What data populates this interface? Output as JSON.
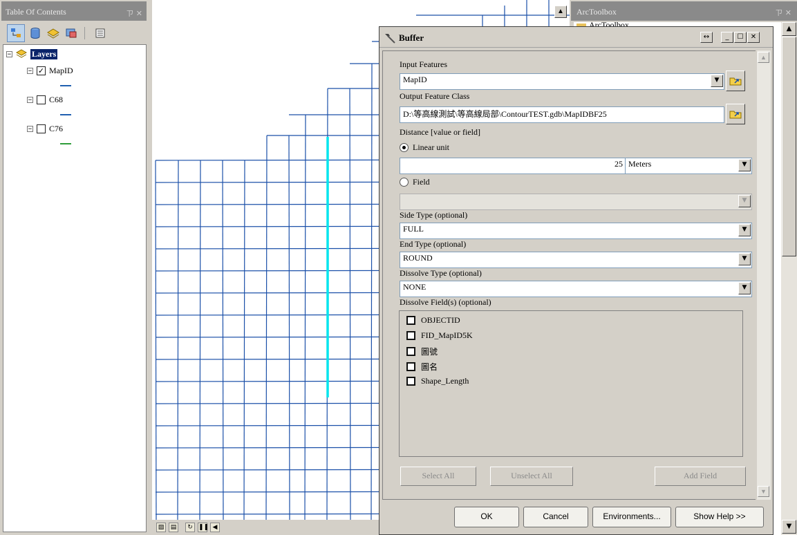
{
  "toc": {
    "title": "Table Of Contents",
    "pin": "ㄗ ✕",
    "toolbar": [
      "list-by-drawing-order",
      "list-by-source",
      "list-by-visibility",
      "list-by-selection",
      "options"
    ],
    "root_label": "Layers",
    "layers": [
      {
        "name": "MapID",
        "checked": true,
        "symbol_color": "#1f5fb0"
      },
      {
        "name": "C68",
        "checked": false,
        "symbol_color": "#1f5fb0"
      },
      {
        "name": "C76",
        "checked": false,
        "symbol_color": "#2e9d3a"
      }
    ]
  },
  "map": {
    "grid_color": "#1a4fa8",
    "highlight_color": "#00e5ee"
  },
  "toolbox": {
    "title": "ArcToolbox",
    "pin": "ㄗ ✕",
    "partial_item": "ArcToolbox"
  },
  "dialog": {
    "title": "Buffer",
    "input_features_label": "Input Features",
    "input_features_value": "MapID",
    "output_label": "Output Feature Class",
    "output_value": "D:\\等高線測試\\等高線局部\\ContourTEST.gdb\\MapIDBF25",
    "distance_label": "Distance [value or field]",
    "linear_unit_label": "Linear unit",
    "distance_value": "25",
    "unit_value": "Meters",
    "field_label": "Field",
    "side_type_label": "Side Type (optional)",
    "side_type_value": "FULL",
    "end_type_label": "End Type (optional)",
    "end_type_value": "ROUND",
    "dissolve_type_label": "Dissolve Type (optional)",
    "dissolve_type_value": "NONE",
    "dissolve_fields_label": "Dissolve Field(s) (optional)",
    "dissolve_fields": [
      "OBJECTID",
      "FID_MapID5K",
      "圖號",
      "圖名",
      "Shape_Length"
    ],
    "select_all": "Select All",
    "unselect_all": "Unselect All",
    "add_field": "Add Field",
    "ok": "OK",
    "cancel": "Cancel",
    "environments": "Environments...",
    "show_help": "Show Help >>"
  }
}
